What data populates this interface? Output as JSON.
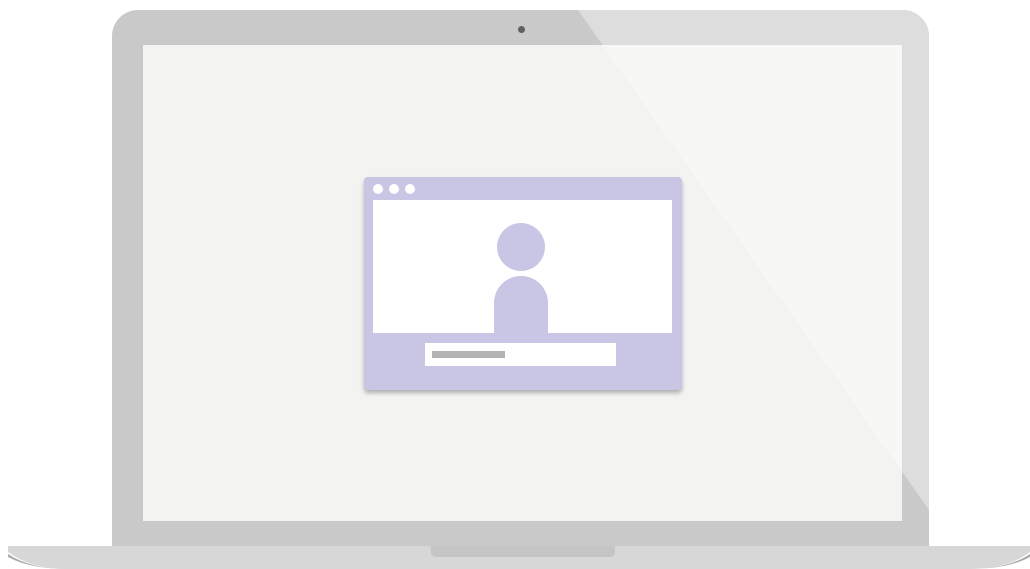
{
  "illustration": {
    "device": "laptop-icon",
    "app_window": {
      "title_bar_dots": [
        "window-dot-1",
        "window-dot-2",
        "window-dot-3"
      ],
      "video_tile": "user-avatar-icon",
      "input_placeholder": "text-placeholder-bar"
    }
  },
  "colors": {
    "bezel": "#c8c9c8",
    "screen": "#f3f3f1",
    "app_accent": "#c8c6e4",
    "camera": "#5f6160",
    "placeholder_bar": "#b3b3b3"
  }
}
